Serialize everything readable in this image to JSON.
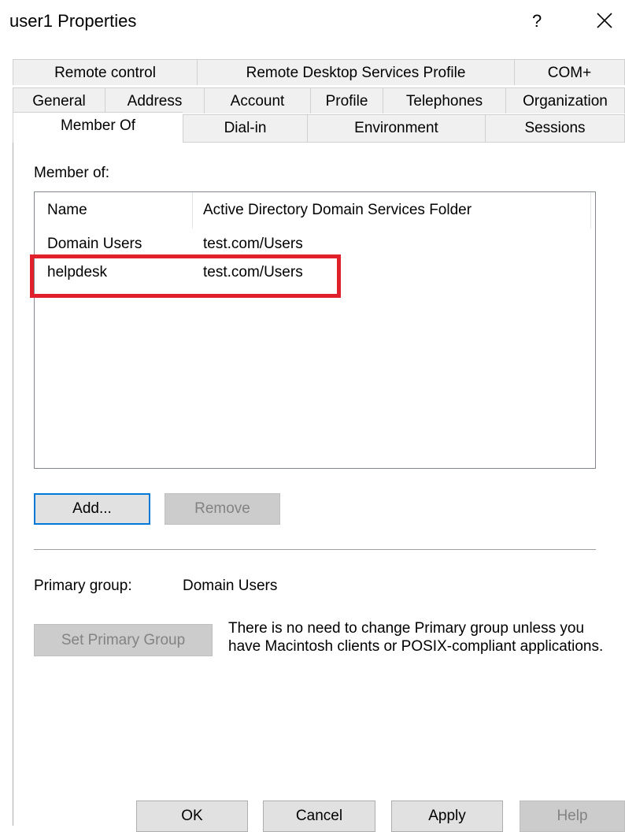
{
  "window": {
    "title": "user1 Properties",
    "help_glyph": "?",
    "close_icon": "close-icon"
  },
  "tabs": {
    "row1": [
      "Remote control",
      "Remote Desktop Services Profile",
      "COM+"
    ],
    "row2": [
      "General",
      "Address",
      "Account",
      "Profile",
      "Telephones",
      "Organization"
    ],
    "row3": [
      "Member Of",
      "Dial-in",
      "Environment",
      "Sessions"
    ],
    "active": "Member Of"
  },
  "member_of": {
    "label": "Member of:",
    "columns": [
      "Name",
      "Active Directory Domain Services Folder"
    ],
    "rows": [
      {
        "name": "Domain Users",
        "folder": "test.com/Users"
      },
      {
        "name": "helpdesk",
        "folder": "test.com/Users"
      }
    ],
    "highlighted_row": "helpdesk",
    "highlight_color": "#e0202a"
  },
  "buttons": {
    "add": "Add...",
    "remove": "Remove",
    "set_primary_group": "Set Primary Group",
    "ok": "OK",
    "cancel": "Cancel",
    "apply": "Apply",
    "help": "Help"
  },
  "primary_group": {
    "label": "Primary group:",
    "value": "Domain Users",
    "note": "There is no need to change Primary group unless you have Macintosh clients or POSIX-compliant applications."
  },
  "colors": {
    "focus": "#0078d7",
    "tab_bg": "#f0f0f0",
    "button_bg": "#e1e1e1"
  }
}
